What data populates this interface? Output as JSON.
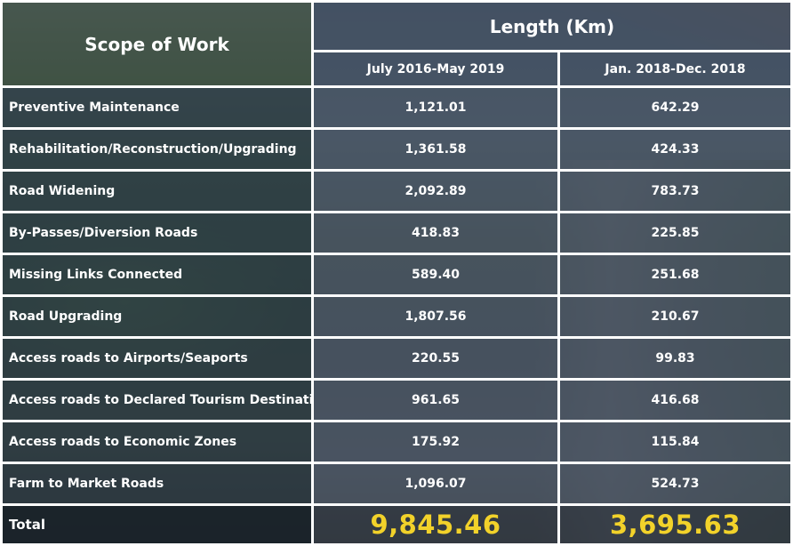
{
  "header": {
    "scope_label": "Scope of Work",
    "length_label": "Length (Km)",
    "period_1": "July 2016-May 2019",
    "period_2": "Jan. 2018-Dec. 2018"
  },
  "rows": [
    {
      "label": "Preventive Maintenance",
      "v1": "1,121.01",
      "v2": "642.29"
    },
    {
      "label": "Rehabilitation/Reconstruction/Upgrading",
      "v1": "1,361.58",
      "v2": "424.33"
    },
    {
      "label": "Road Widening",
      "v1": "2,092.89",
      "v2": "783.73"
    },
    {
      "label": "By-Passes/Diversion Roads",
      "v1": "418.83",
      "v2": "225.85"
    },
    {
      "label": "Missing Links Connected",
      "v1": "589.40",
      "v2": "251.68"
    },
    {
      "label": "Road Upgrading",
      "v1": "1,807.56",
      "v2": "210.67"
    },
    {
      "label": "Access roads to Airports/Seaports",
      "v1": "220.55",
      "v2": "99.83"
    },
    {
      "label": "Access roads to Declared Tourism Destination",
      "v1": "961.65",
      "v2": "416.68"
    },
    {
      "label": "Access roads to Economic Zones",
      "v1": "175.92",
      "v2": "115.84"
    },
    {
      "label": "Farm to Market Roads",
      "v1": "1,096.07",
      "v2": "524.73"
    }
  ],
  "total": {
    "label": "Total",
    "v1": "9,845.46",
    "v2": "3,695.63"
  },
  "colors": {
    "total_value": "#f2d22a",
    "grid_line": "#ffffff"
  }
}
